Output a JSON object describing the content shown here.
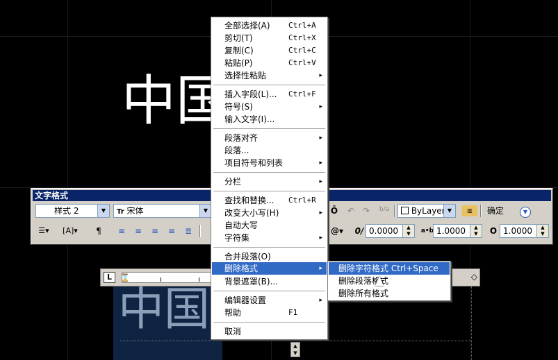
{
  "canvas": {
    "big_text": "中国",
    "editor_text": "中国"
  },
  "text_format": {
    "title": "文字格式",
    "style_value": "样式 2",
    "font_icon": "Tr",
    "font_value": "宋体",
    "bold_icon": "Ō",
    "undo_icon": "↶",
    "redo_icon": "↷",
    "stack_icon": "b/a",
    "color_value": "ByLayer",
    "ruler_icon": "ruler-icon",
    "ok_label": "确定",
    "options_icon": "chevron-down-circle-icon",
    "oblique_label": "0/",
    "oblique_value": "0.0000",
    "tracking_label": "a•b",
    "tracking_value": "1.0000",
    "width_label": "O",
    "width_value": "1.0000",
    "at_icon": "@▾"
  },
  "ruler": {
    "tab_label": "L"
  },
  "context_menu": {
    "items": [
      {
        "label": "全部选择(A)",
        "shortcut": "Ctrl+A"
      },
      {
        "label": "剪切(T)",
        "shortcut": "Ctrl+X"
      },
      {
        "label": "复制(C)",
        "shortcut": "Ctrl+C"
      },
      {
        "label": "粘贴(P)",
        "shortcut": "Ctrl+V"
      },
      {
        "label": "选择性粘贴",
        "submenu": "▸"
      },
      {
        "label": "插入字段(L)...",
        "shortcut": "Ctrl+F"
      },
      {
        "label": "符号(S)",
        "submenu": "▸"
      },
      {
        "label": "输入文字(I)..."
      },
      {
        "label": "段落对齐",
        "submenu": "▸"
      },
      {
        "label": "段落..."
      },
      {
        "label": "项目符号和列表",
        "submenu": "▸"
      },
      {
        "label": "分栏",
        "submenu": "▸"
      },
      {
        "label": "查找和替换...",
        "shortcut": "Ctrl+R"
      },
      {
        "label": "改变大小写(H)",
        "submenu": "▸"
      },
      {
        "label": "自动大写"
      },
      {
        "label": "字符集",
        "submenu": "▸"
      },
      {
        "label": "合并段落(O)"
      },
      {
        "label": "删除格式",
        "submenu": "▸"
      },
      {
        "label": "背景遮罩(B)..."
      },
      {
        "label": "编辑器设置",
        "submenu": "▸"
      },
      {
        "label": "帮助",
        "shortcut": "F1"
      },
      {
        "label": "取消"
      }
    ]
  },
  "submenu": {
    "items": [
      {
        "label": "删除字符格式 Ctrl+Space"
      },
      {
        "label": "删除段落格式"
      },
      {
        "label": "删除所有格式"
      }
    ]
  }
}
